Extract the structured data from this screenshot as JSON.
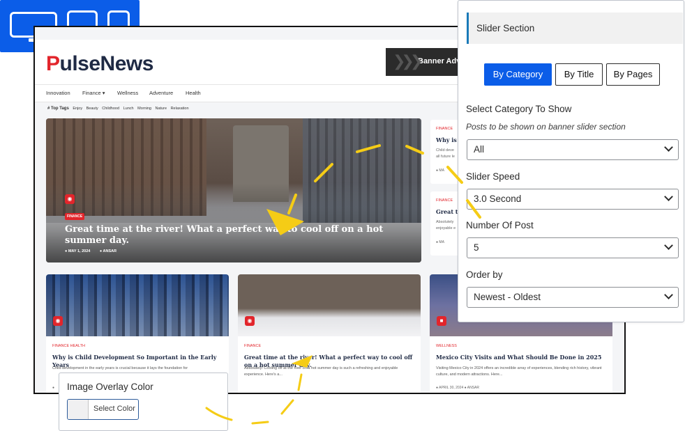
{
  "devices": {
    "desktop_icon": "desktop-icon",
    "tablet_icon": "tablet-icon",
    "mobile_icon": "mobile-icon"
  },
  "site": {
    "logo": {
      "first": "P",
      "rest": "ulse",
      "second": "News"
    },
    "banner_ad": "Banner Adv",
    "nav": [
      "Innovation",
      "Finance ▾",
      "Wellness",
      "Adventure",
      "Health"
    ],
    "top_tags_label": "# Top Tags",
    "tags": [
      "Enjoy",
      "Beauty",
      "Childhood",
      "Lunch",
      "Morning",
      "Nature",
      "Relaxation"
    ],
    "hero": {
      "category": "FINANCE",
      "title": "Great time at the river! What a perfect way to cool off on a hot summer day.",
      "date": "● MAY 1, 2024",
      "author": "● ANSAR"
    },
    "side_cards": [
      {
        "category": "FINANCE",
        "title": "Why is C",
        "excerpt_1": "Child deve",
        "excerpt_2": "all future le",
        "meta": "● MA"
      },
      {
        "category": "FINANCE",
        "title": "Great ti",
        "excerpt_1": "Absolutely",
        "excerpt_2": "enjoyable e",
        "meta": "● MA"
      }
    ],
    "cards": [
      {
        "category": "FINANCE  HEALTH",
        "title": "Why is Child Development So Important in the Early Years",
        "excerpt": "Child development in the early years is crucial because it lays the foundation for",
        "meta": "●"
      },
      {
        "category": "FINANCE",
        "title": "Great time at the river! What a perfect way to cool off on a hot summer day.",
        "excerpt": "Absolutely! Cooling off at the river on a hot summer day is such a refreshing and enjoyable experience. Here's a...",
        "meta": ""
      },
      {
        "category": "WELLNESS",
        "title": "Mexico City Visits and What Should Be Done in 2025",
        "excerpt": "Visiting Mexico City in 2024 offers an incredible array of experiences, blending rich history, vibrant culture, and modern attractions. Here...",
        "meta": "● APRIL 30, 2024   ● ANSAR"
      }
    ]
  },
  "slider_panel": {
    "title": "Slider Section",
    "tabs": [
      "By Category",
      "By Title",
      "By Pages"
    ],
    "category": {
      "label": "Select Category To Show",
      "help": "Posts to be shown on banner slider section",
      "value": "All"
    },
    "speed": {
      "label": "Slider Speed",
      "value": "3.0 Second"
    },
    "number": {
      "label": "Number Of Post",
      "value": "5"
    },
    "order": {
      "label": "Order by",
      "value": "Newest - Oldest"
    }
  },
  "overlay_panel": {
    "label": "Image Overlay Color",
    "button": "Select Color"
  },
  "colors": {
    "accent_blue": "#0b5de8",
    "brand_red": "#e2252b",
    "annotation_yellow": "#f5cc16"
  }
}
